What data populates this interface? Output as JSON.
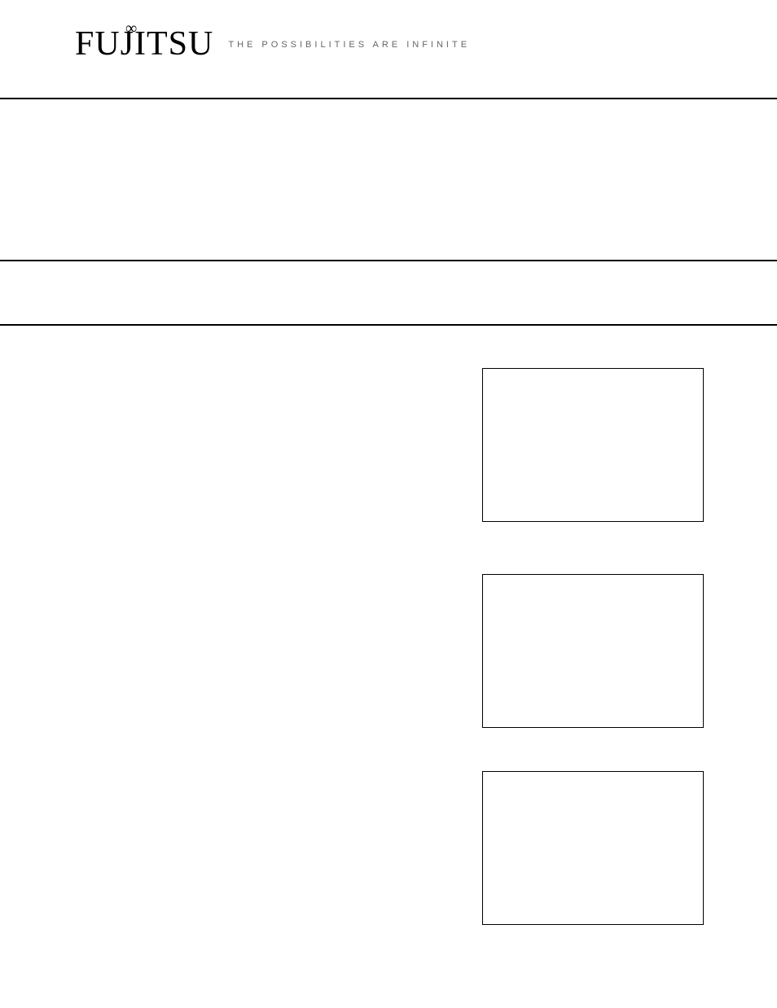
{
  "header": {
    "brand": "FUJITSU",
    "tagline": "THE POSSIBILITIES ARE INFINITE"
  }
}
